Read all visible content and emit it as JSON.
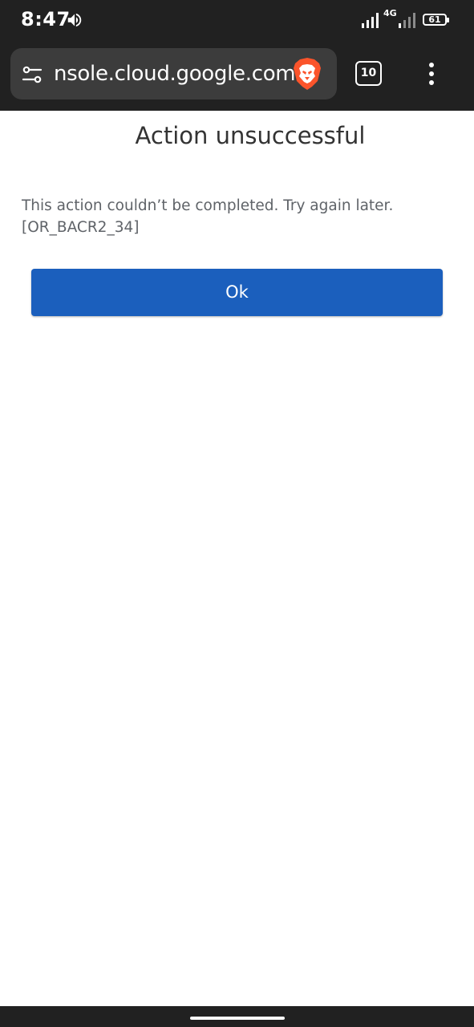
{
  "status_bar": {
    "time": "8:47",
    "network_type": "4G",
    "battery": "61",
    "icons": [
      "volume-icon",
      "signal-icon",
      "signal-icon-2",
      "battery-icon"
    ]
  },
  "browser": {
    "url": "nsole.cloud.google.com",
    "tab_count": "10",
    "icons": [
      "site-settings-icon",
      "brave-lion-icon",
      "tabs-icon",
      "more-vert-icon"
    ],
    "brand_color": "#fb542b"
  },
  "dialog": {
    "title": "Action unsuccessful",
    "message_line1": "This action couldn’t be completed. Try again later.",
    "message_line2": "[OR_BACR2_34]",
    "ok_label": "Ok",
    "accent_color": "#1b5fbd"
  }
}
